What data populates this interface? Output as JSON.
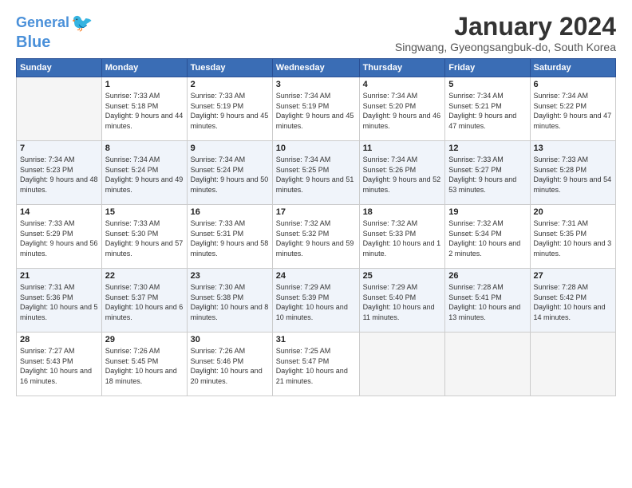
{
  "header": {
    "logo_line1": "General",
    "logo_line2": "Blue",
    "month_year": "January 2024",
    "location": "Singwang, Gyeongsangbuk-do, South Korea"
  },
  "weekdays": [
    "Sunday",
    "Monday",
    "Tuesday",
    "Wednesday",
    "Thursday",
    "Friday",
    "Saturday"
  ],
  "weeks": [
    [
      {
        "day": "",
        "sunrise": "",
        "sunset": "",
        "daylight": ""
      },
      {
        "day": "1",
        "sunrise": "Sunrise: 7:33 AM",
        "sunset": "Sunset: 5:18 PM",
        "daylight": "Daylight: 9 hours and 44 minutes."
      },
      {
        "day": "2",
        "sunrise": "Sunrise: 7:33 AM",
        "sunset": "Sunset: 5:19 PM",
        "daylight": "Daylight: 9 hours and 45 minutes."
      },
      {
        "day": "3",
        "sunrise": "Sunrise: 7:34 AM",
        "sunset": "Sunset: 5:19 PM",
        "daylight": "Daylight: 9 hours and 45 minutes."
      },
      {
        "day": "4",
        "sunrise": "Sunrise: 7:34 AM",
        "sunset": "Sunset: 5:20 PM",
        "daylight": "Daylight: 9 hours and 46 minutes."
      },
      {
        "day": "5",
        "sunrise": "Sunrise: 7:34 AM",
        "sunset": "Sunset: 5:21 PM",
        "daylight": "Daylight: 9 hours and 47 minutes."
      },
      {
        "day": "6",
        "sunrise": "Sunrise: 7:34 AM",
        "sunset": "Sunset: 5:22 PM",
        "daylight": "Daylight: 9 hours and 47 minutes."
      }
    ],
    [
      {
        "day": "7",
        "sunrise": "Sunrise: 7:34 AM",
        "sunset": "Sunset: 5:23 PM",
        "daylight": "Daylight: 9 hours and 48 minutes."
      },
      {
        "day": "8",
        "sunrise": "Sunrise: 7:34 AM",
        "sunset": "Sunset: 5:24 PM",
        "daylight": "Daylight: 9 hours and 49 minutes."
      },
      {
        "day": "9",
        "sunrise": "Sunrise: 7:34 AM",
        "sunset": "Sunset: 5:24 PM",
        "daylight": "Daylight: 9 hours and 50 minutes."
      },
      {
        "day": "10",
        "sunrise": "Sunrise: 7:34 AM",
        "sunset": "Sunset: 5:25 PM",
        "daylight": "Daylight: 9 hours and 51 minutes."
      },
      {
        "day": "11",
        "sunrise": "Sunrise: 7:34 AM",
        "sunset": "Sunset: 5:26 PM",
        "daylight": "Daylight: 9 hours and 52 minutes."
      },
      {
        "day": "12",
        "sunrise": "Sunrise: 7:33 AM",
        "sunset": "Sunset: 5:27 PM",
        "daylight": "Daylight: 9 hours and 53 minutes."
      },
      {
        "day": "13",
        "sunrise": "Sunrise: 7:33 AM",
        "sunset": "Sunset: 5:28 PM",
        "daylight": "Daylight: 9 hours and 54 minutes."
      }
    ],
    [
      {
        "day": "14",
        "sunrise": "Sunrise: 7:33 AM",
        "sunset": "Sunset: 5:29 PM",
        "daylight": "Daylight: 9 hours and 56 minutes."
      },
      {
        "day": "15",
        "sunrise": "Sunrise: 7:33 AM",
        "sunset": "Sunset: 5:30 PM",
        "daylight": "Daylight: 9 hours and 57 minutes."
      },
      {
        "day": "16",
        "sunrise": "Sunrise: 7:33 AM",
        "sunset": "Sunset: 5:31 PM",
        "daylight": "Daylight: 9 hours and 58 minutes."
      },
      {
        "day": "17",
        "sunrise": "Sunrise: 7:32 AM",
        "sunset": "Sunset: 5:32 PM",
        "daylight": "Daylight: 9 hours and 59 minutes."
      },
      {
        "day": "18",
        "sunrise": "Sunrise: 7:32 AM",
        "sunset": "Sunset: 5:33 PM",
        "daylight": "Daylight: 10 hours and 1 minute."
      },
      {
        "day": "19",
        "sunrise": "Sunrise: 7:32 AM",
        "sunset": "Sunset: 5:34 PM",
        "daylight": "Daylight: 10 hours and 2 minutes."
      },
      {
        "day": "20",
        "sunrise": "Sunrise: 7:31 AM",
        "sunset": "Sunset: 5:35 PM",
        "daylight": "Daylight: 10 hours and 3 minutes."
      }
    ],
    [
      {
        "day": "21",
        "sunrise": "Sunrise: 7:31 AM",
        "sunset": "Sunset: 5:36 PM",
        "daylight": "Daylight: 10 hours and 5 minutes."
      },
      {
        "day": "22",
        "sunrise": "Sunrise: 7:30 AM",
        "sunset": "Sunset: 5:37 PM",
        "daylight": "Daylight: 10 hours and 6 minutes."
      },
      {
        "day": "23",
        "sunrise": "Sunrise: 7:30 AM",
        "sunset": "Sunset: 5:38 PM",
        "daylight": "Daylight: 10 hours and 8 minutes."
      },
      {
        "day": "24",
        "sunrise": "Sunrise: 7:29 AM",
        "sunset": "Sunset: 5:39 PM",
        "daylight": "Daylight: 10 hours and 10 minutes."
      },
      {
        "day": "25",
        "sunrise": "Sunrise: 7:29 AM",
        "sunset": "Sunset: 5:40 PM",
        "daylight": "Daylight: 10 hours and 11 minutes."
      },
      {
        "day": "26",
        "sunrise": "Sunrise: 7:28 AM",
        "sunset": "Sunset: 5:41 PM",
        "daylight": "Daylight: 10 hours and 13 minutes."
      },
      {
        "day": "27",
        "sunrise": "Sunrise: 7:28 AM",
        "sunset": "Sunset: 5:42 PM",
        "daylight": "Daylight: 10 hours and 14 minutes."
      }
    ],
    [
      {
        "day": "28",
        "sunrise": "Sunrise: 7:27 AM",
        "sunset": "Sunset: 5:43 PM",
        "daylight": "Daylight: 10 hours and 16 minutes."
      },
      {
        "day": "29",
        "sunrise": "Sunrise: 7:26 AM",
        "sunset": "Sunset: 5:45 PM",
        "daylight": "Daylight: 10 hours and 18 minutes."
      },
      {
        "day": "30",
        "sunrise": "Sunrise: 7:26 AM",
        "sunset": "Sunset: 5:46 PM",
        "daylight": "Daylight: 10 hours and 20 minutes."
      },
      {
        "day": "31",
        "sunrise": "Sunrise: 7:25 AM",
        "sunset": "Sunset: 5:47 PM",
        "daylight": "Daylight: 10 hours and 21 minutes."
      },
      {
        "day": "",
        "sunrise": "",
        "sunset": "",
        "daylight": ""
      },
      {
        "day": "",
        "sunrise": "",
        "sunset": "",
        "daylight": ""
      },
      {
        "day": "",
        "sunrise": "",
        "sunset": "",
        "daylight": ""
      }
    ]
  ]
}
